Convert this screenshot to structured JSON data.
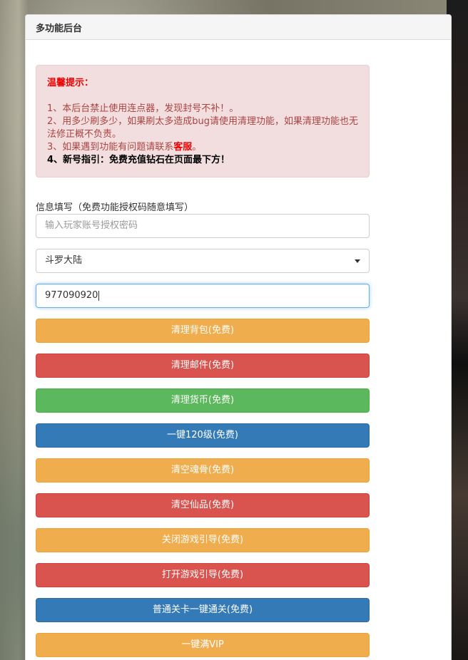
{
  "panel": {
    "title": "多功能后台"
  },
  "notice": {
    "title": "温馨提示：",
    "line1": "1、本后台禁止使用连点器，发现封号不补！。",
    "line2": "2、用多少刷多少，如果刷太多造成bug请使用清理功能，如果清理功能也无法修正概不负责。",
    "line3_prefix": "3、如果遇到功能有问题请联系",
    "line3_em": "客服",
    "line3_suffix": "。",
    "line4": "4、新号指引：免费充值钻石在页面最下方！"
  },
  "form": {
    "label": "信息填写（免费功能授权码随意填写）",
    "auth_placeholder": "输入玩家账号授权密码",
    "server_selected": "斗罗大陆",
    "account_value": "977090920"
  },
  "buttons": [
    {
      "label": "清理背包(免费)",
      "color": "#f0ad4e"
    },
    {
      "label": "清理邮件(免费)",
      "color": "#d9534f"
    },
    {
      "label": "清理货币(免费)",
      "color": "#5cb85c"
    },
    {
      "label": "一键120级(免费)",
      "color": "#337ab7"
    },
    {
      "label": "清空魂骨(免费)",
      "color": "#f0ad4e"
    },
    {
      "label": "清空仙品(免费)",
      "color": "#d9534f"
    },
    {
      "label": "关闭游戏引导(免费)",
      "color": "#f0ad4e"
    },
    {
      "label": "打开游戏引导(免费)",
      "color": "#d9534f"
    },
    {
      "label": "普通关卡一键通关(免费)",
      "color": "#337ab7"
    },
    {
      "label": "一键满VIP",
      "color": "#f0ad4e"
    }
  ]
}
